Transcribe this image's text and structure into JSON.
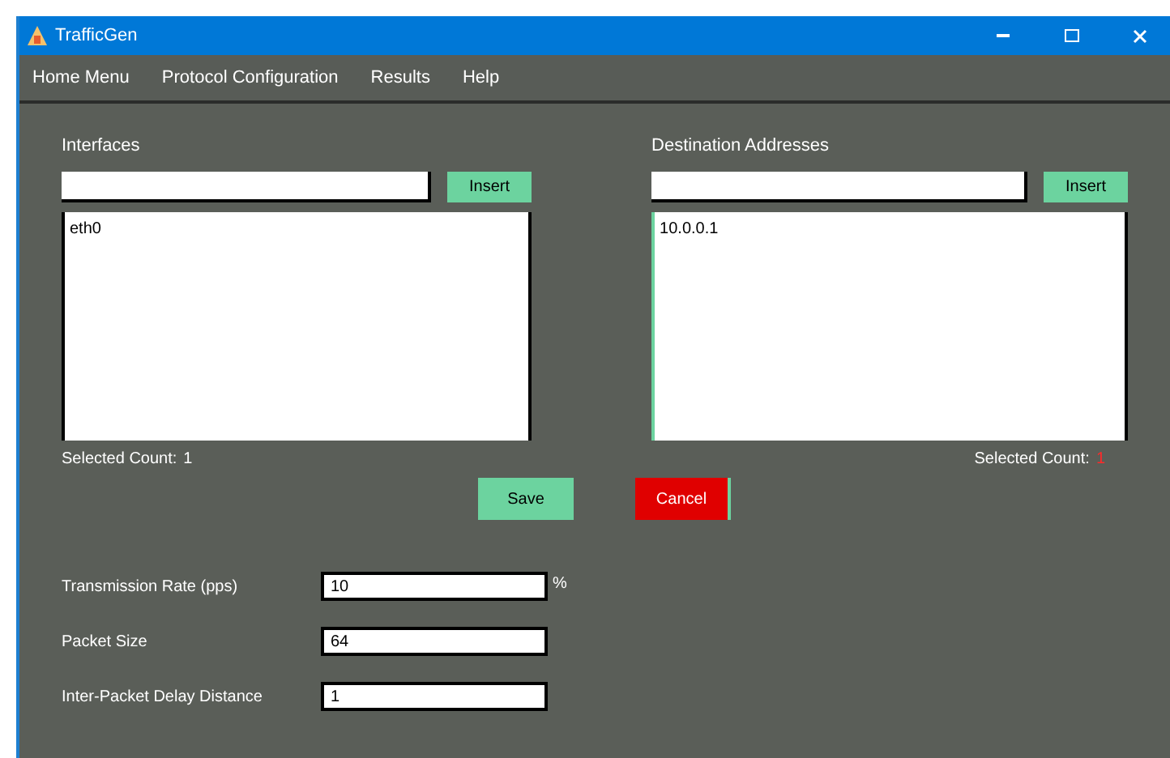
{
  "window": {
    "title": "TrafficGen"
  },
  "menu": [
    "Home Menu",
    "Protocol Configuration",
    "Results",
    "Help"
  ],
  "left_panel": {
    "label": "Interfaces",
    "button": "Insert",
    "items": [
      "eth0"
    ],
    "count_label": "Selected Count:",
    "count": "1"
  },
  "right_panel": {
    "label": "Destination Addresses",
    "button": "Insert",
    "items": [
      "10.0.0.1"
    ],
    "count_label": "Selected Count:",
    "count": "1"
  },
  "actions": [
    {
      "label": "Save",
      "kind": "primary"
    },
    {
      "label": "Cancel",
      "kind": "danger"
    }
  ],
  "fields": [
    {
      "label": "Transmission Rate (pps)",
      "value": "10",
      "unit": "%"
    },
    {
      "label": "Packet Size",
      "value": "64"
    },
    {
      "label": "Inter-Packet Delay Distance",
      "value": "1"
    }
  ]
}
